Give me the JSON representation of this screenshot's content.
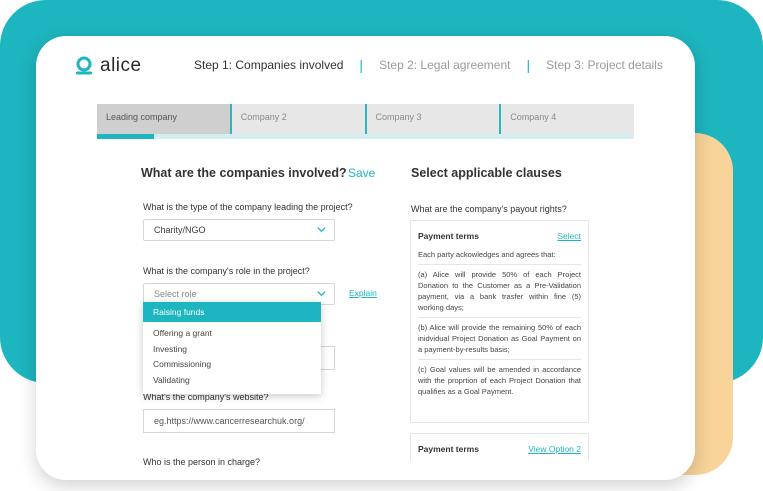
{
  "brand": {
    "name": "alice",
    "color": "#1db5bf"
  },
  "steps": [
    {
      "label": "Step 1:  Companies involved",
      "active": true
    },
    {
      "label": "Step 2:  Legal agreement",
      "active": false
    },
    {
      "label": "Step 3:  Project details",
      "active": false
    }
  ],
  "tabs": [
    {
      "label": "Leading company",
      "active": true
    },
    {
      "label": "Company 2",
      "active": false
    },
    {
      "label": "Company 3",
      "active": false
    },
    {
      "label": "Company 4",
      "active": false
    }
  ],
  "form": {
    "heading": "What are the companies involved?",
    "save_label": "Save",
    "q_type": "What is the type of the company leading the project?",
    "type_value": "Charity/NGO",
    "q_role": "What is the company's role in the project?",
    "role_placeholder": "Select role",
    "explain_label": "Explain",
    "role_options": [
      "Raising funds",
      "Offering a grant",
      "Investing",
      "Commissioning",
      "Validating"
    ],
    "q_website": "What's the company's website?",
    "website_value": "eg.https://www.cancerresearchuk.org/",
    "q_person": "Who is the person in charge?"
  },
  "clauses": {
    "heading": "Select applicable clauses",
    "q_payout": "What are the company's payout rights?",
    "card1": {
      "title": "Payment terms",
      "action": "Select",
      "intro": "Each party ackowledges and agrees that:",
      "a": "(a)   Alice will provide 50% of each Project Donation to the Customer as a Pre-Validation payment, via a bank trasfer within fine (5) working days;",
      "b": "(b) Alice will provide the remaining 50% of each inidvidual Project Donation as Goal Payment on a payment-by-results basis;",
      "c": "(c)  Goal values will be amended in accordance with the proprtion of each Project Donation that qualifies as a Goal Payment."
    },
    "card2": {
      "title": "Payment terms",
      "action": "View Option 2"
    }
  }
}
